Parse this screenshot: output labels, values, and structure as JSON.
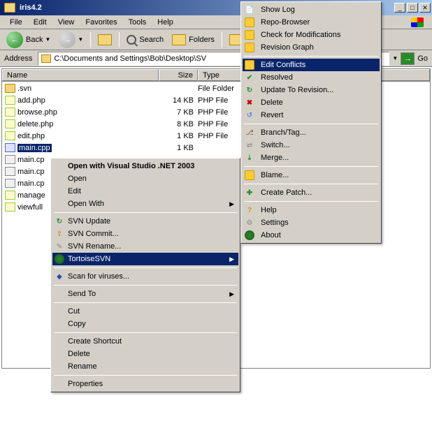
{
  "window": {
    "title": "iris4.2"
  },
  "menubar": {
    "file": "File",
    "edit": "Edit",
    "view": "View",
    "favorites": "Favorites",
    "tools": "Tools",
    "help": "Help"
  },
  "toolbar": {
    "back": "Back",
    "search": "Search",
    "folders": "Folders"
  },
  "address": {
    "label": "Address",
    "path": "C:\\Documents and Settings\\Bob\\Desktop\\SV",
    "go": "Go"
  },
  "columns": {
    "name": "Name",
    "size": "Size",
    "type": "Type"
  },
  "files": [
    {
      "name": ".svn",
      "size": "",
      "type": "File Folder",
      "icon": "fi-folder"
    },
    {
      "name": "add.php",
      "size": "14 KB",
      "type": "PHP File",
      "icon": "fi-php"
    },
    {
      "name": "browse.php",
      "size": "7 KB",
      "type": "PHP File",
      "icon": "fi-php"
    },
    {
      "name": "delete.php",
      "size": "8 KB",
      "type": "PHP File",
      "icon": "fi-php"
    },
    {
      "name": "edit.php",
      "size": "1 KB",
      "type": "PHP File",
      "icon": "fi-php"
    },
    {
      "name": "main.cpp",
      "size": "1 KB",
      "type": "",
      "icon": "fi-cpp",
      "selected": true
    },
    {
      "name": "main.cp",
      "size": "",
      "type": "",
      "icon": "fi-other",
      "clipped": true
    },
    {
      "name": "main.cp",
      "size": "",
      "type": "",
      "icon": "fi-other",
      "clipped": true
    },
    {
      "name": "main.cp",
      "size": "",
      "type": "",
      "icon": "fi-other",
      "clipped": true
    },
    {
      "name": "manage",
      "size": "",
      "type": "",
      "icon": "fi-php",
      "clipped": true
    },
    {
      "name": "viewfull",
      "size": "",
      "type": "",
      "icon": "fi-php",
      "clipped": true
    }
  ],
  "ctx1": {
    "open_vs": "Open with Visual Studio .NET 2003",
    "open": "Open",
    "edit": "Edit",
    "open_with": "Open With",
    "svn_update": "SVN Update",
    "svn_commit": "SVN Commit...",
    "svn_rename": "SVN Rename...",
    "tortoisesvn": "TortoiseSVN",
    "scan": "Scan for viruses...",
    "send_to": "Send To",
    "cut": "Cut",
    "copy": "Copy",
    "shortcut": "Create Shortcut",
    "delete": "Delete",
    "rename": "Rename",
    "properties": "Properties"
  },
  "ctx2": {
    "show_log": "Show Log",
    "repo_browser": "Repo-Browser",
    "check_mods": "Check for Modifications",
    "rev_graph": "Revision Graph",
    "edit_conflicts": "Edit Conflicts",
    "resolved": "Resolved",
    "update_rev": "Update To Revision...",
    "delete": "Delete",
    "revert": "Revert",
    "branch": "Branch/Tag...",
    "switch": "Switch...",
    "merge": "Merge...",
    "blame": "Blame...",
    "create_patch": "Create Patch...",
    "help": "Help",
    "settings": "Settings",
    "about": "About"
  }
}
